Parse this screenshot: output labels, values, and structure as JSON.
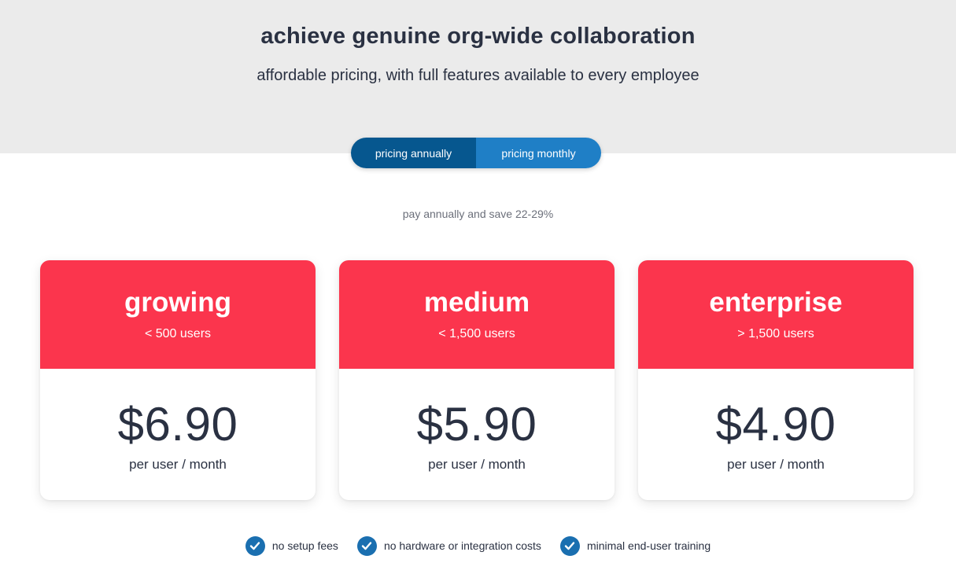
{
  "hero": {
    "title": "achieve genuine org-wide collaboration",
    "subtitle": "affordable pricing, with full features available to every employee"
  },
  "toggle": {
    "annual_label": "pricing annually",
    "monthly_label": "pricing monthly",
    "selected": "annual"
  },
  "save_note": "pay annually and save 22-29%",
  "plans": [
    {
      "name": "growing",
      "users": "< 500 users",
      "price": "$6.90",
      "per": "per user / month"
    },
    {
      "name": "medium",
      "users": "< 1,500 users",
      "price": "$5.90",
      "per": "per user / month"
    },
    {
      "name": "enterprise",
      "users": "> 1,500 users",
      "price": "$4.90",
      "per": "per user / month"
    }
  ],
  "features": [
    {
      "icon": "check-circle-icon",
      "label": "no setup fees"
    },
    {
      "icon": "check-circle-icon",
      "label": "no hardware or integration costs"
    },
    {
      "icon": "check-circle-icon",
      "label": "minimal end-user training"
    }
  ],
  "colors": {
    "hero_bg": "#ebebeb",
    "card_header": "#fb354d",
    "toggle_active": "#06578f",
    "toggle_inactive": "#1f7fc6",
    "check": "#1a6fb0",
    "text": "#2a3142"
  }
}
